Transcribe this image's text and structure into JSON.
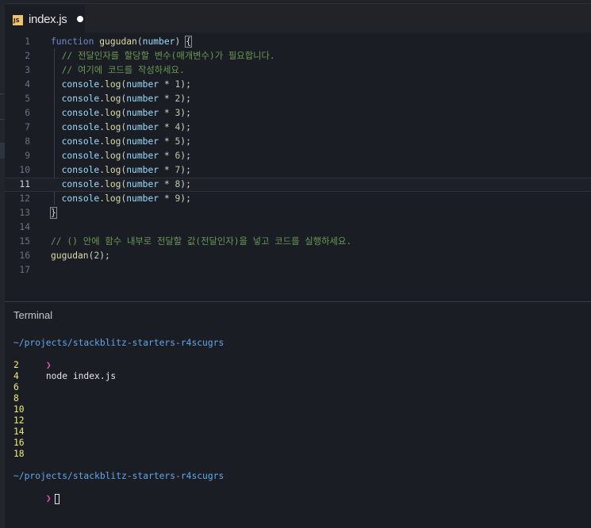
{
  "tab": {
    "icon": "js-file-icon",
    "icon_text": "JS",
    "title": "index.js",
    "unsaved": true
  },
  "editor": {
    "current_line": 11,
    "lines": [
      {
        "n": "1",
        "text": "function gugudan(number) {"
      },
      {
        "n": "2",
        "text": "  // 전달인자를 할당할 변수(매개변수)가 필요합니다."
      },
      {
        "n": "3",
        "text": "  // 여기에 코드를 작성하세요."
      },
      {
        "n": "4",
        "text": "  console.log(number * 1);"
      },
      {
        "n": "5",
        "text": "  console.log(number * 2);"
      },
      {
        "n": "6",
        "text": "  console.log(number * 3);"
      },
      {
        "n": "7",
        "text": "  console.log(number * 4);"
      },
      {
        "n": "8",
        "text": "  console.log(number * 5);"
      },
      {
        "n": "9",
        "text": "  console.log(number * 6);"
      },
      {
        "n": "10",
        "text": "  console.log(number * 7);"
      },
      {
        "n": "11",
        "text": "  console.log(number * 8);"
      },
      {
        "n": "12",
        "text": "  console.log(number * 9);"
      },
      {
        "n": "13",
        "text": "}"
      },
      {
        "n": "14",
        "text": ""
      },
      {
        "n": "15",
        "text": "// () 안에 함수 내부로 전달할 값(전달인자)을 넣고 코드를 실행하세요."
      },
      {
        "n": "16",
        "text": "gugudan(2);"
      },
      {
        "n": "17",
        "text": ""
      }
    ]
  },
  "terminal": {
    "title": "Terminal",
    "path": "~/projects/stackblitz-starters-r4scugrs",
    "prompt_symbol": "❯",
    "command": "node index.js",
    "output": [
      "2",
      "4",
      "6",
      "8",
      "10",
      "12",
      "14",
      "16",
      "18"
    ],
    "path_after": "~/projects/stackblitz-starters-r4scugrs"
  },
  "colors": {
    "background": "#1b1d24",
    "keyword": "#6f8bd4",
    "function": "#dcdcaa",
    "variable": "#9cdcfe",
    "comment": "#6a9955",
    "terminal_path": "#5fa8e8",
    "terminal_prompt": "#e24fb8",
    "terminal_output": "#f1ec7a"
  }
}
